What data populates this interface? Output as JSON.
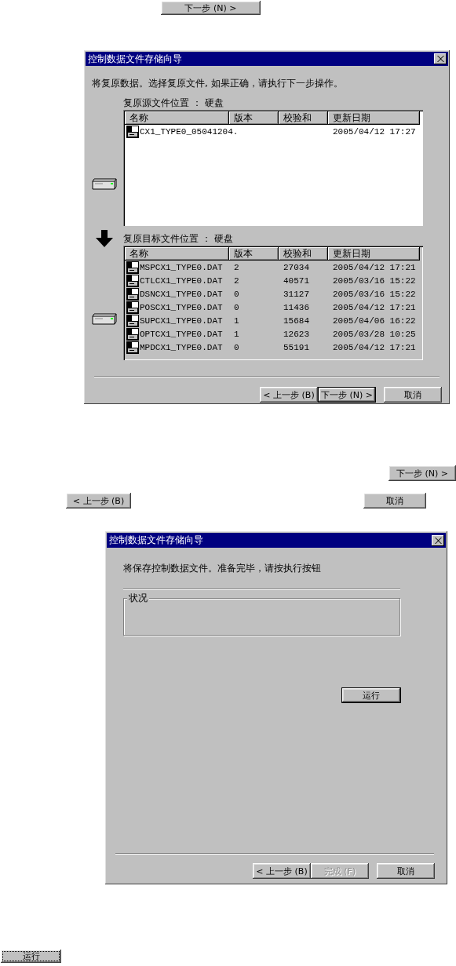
{
  "top_button": {
    "label": "下一步 (N) >",
    "disabled": false,
    "default": false
  },
  "restore_dialog": {
    "title": "控制数据文件存储向导",
    "instruction": "将复原数据。选择复原文件, 如果正确，请执行下一步操作。",
    "source": {
      "label": "复原源文件位置 ： 硬盘",
      "disabled": false,
      "columns": [
        "名称",
        "版本",
        "校验和",
        "更新日期"
      ],
      "rows": [
        {
          "name": "CX1_TYPE0_05041204.",
          "version": "",
          "checksum": "",
          "date": "2005/04/12 17:27"
        }
      ]
    },
    "target": {
      "label": "复原目标文件位置 ： 硬盘",
      "disabled": true,
      "columns": [
        "名称",
        "版本",
        "校验和",
        "更新日期"
      ],
      "rows": [
        {
          "name": "MSPCX1_TYPE0.DAT",
          "version": "2",
          "checksum": "27034",
          "date": "2005/04/12 17:21"
        },
        {
          "name": "CTLCX1_TYPE0.DAT",
          "version": "2",
          "checksum": "40571",
          "date": "2005/03/16 15:22"
        },
        {
          "name": "DSNCX1_TYPE0.DAT",
          "version": "0",
          "checksum": "31127",
          "date": "2005/03/16 15:22"
        },
        {
          "name": "POSCX1_TYPE0.DAT",
          "version": "0",
          "checksum": "11436",
          "date": "2005/04/12 17:21"
        },
        {
          "name": "SUPCX1_TYPE0.DAT",
          "version": "1",
          "checksum": "15684",
          "date": "2005/04/06 16:22"
        },
        {
          "name": "OPTCX1_TYPE0.DAT",
          "version": "1",
          "checksum": "12623",
          "date": "2005/03/28 10:25"
        },
        {
          "name": "MPDCX1_TYPE0.DAT",
          "version": "0",
          "checksum": "55191",
          "date": "2005/04/12 17:21"
        }
      ]
    },
    "buttons": [
      {
        "label": "< 上一步 (B)",
        "disabled": false,
        "default": false
      },
      {
        "label": "下一步 (N) >",
        "disabled": false,
        "default": true
      },
      {
        "label": "取消",
        "disabled": false,
        "default": false
      }
    ]
  },
  "loose_buttons": [
    {
      "label": "下一步 (N) >",
      "disabled": false,
      "default": false
    },
    {
      "label": "< 上一步 (B)",
      "disabled": false,
      "default": false
    },
    {
      "label": "取消",
      "disabled": false,
      "default": false
    }
  ],
  "save_dialog": {
    "title": "控制数据文件存储向导",
    "instruction": "将保存控制数据文件。准备完毕，请按执行按钮",
    "status_label": "状况",
    "run_button": {
      "label": "运行",
      "disabled": false,
      "default": true
    },
    "buttons": [
      {
        "label": "< 上一步 (B)",
        "disabled": false,
        "default": false
      },
      {
        "label": "完成 (F)",
        "disabled": true,
        "default": false
      },
      {
        "label": "取消",
        "disabled": false,
        "default": false
      }
    ]
  },
  "bottom_button": {
    "label": "运行",
    "disabled": false,
    "default": false,
    "focused": true
  }
}
